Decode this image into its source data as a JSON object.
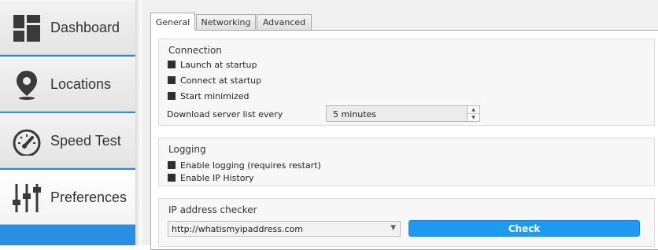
{
  "sidebar": {
    "items": [
      {
        "label": "Dashboard",
        "icon": "dashboard-icon"
      },
      {
        "label": "Locations",
        "icon": "location-pin-icon"
      },
      {
        "label": "Speed Test",
        "icon": "speedometer-icon"
      },
      {
        "label": "Preferences",
        "icon": "sliders-icon"
      }
    ],
    "active": "Preferences",
    "accent_color": "#2a8fe3"
  },
  "tabs": [
    "General",
    "Networking",
    "Advanced"
  ],
  "active_tab": "General",
  "connection": {
    "title": "Connection",
    "launch_at_startup": "Launch at startup",
    "connect_at_startup": "Connect at startup",
    "start_minimized": "Start minimized",
    "download_label": "Download server list every",
    "download_value": "5 minutes"
  },
  "logging": {
    "title": "Logging",
    "enable_logging": "Enable logging (requires restart)",
    "enable_ip_history": "Enable IP History"
  },
  "ip_checker": {
    "title": "IP address checker",
    "url": "http://whatismyipaddress.com",
    "check_label": "Check",
    "button_color": "#1e9bf0"
  }
}
